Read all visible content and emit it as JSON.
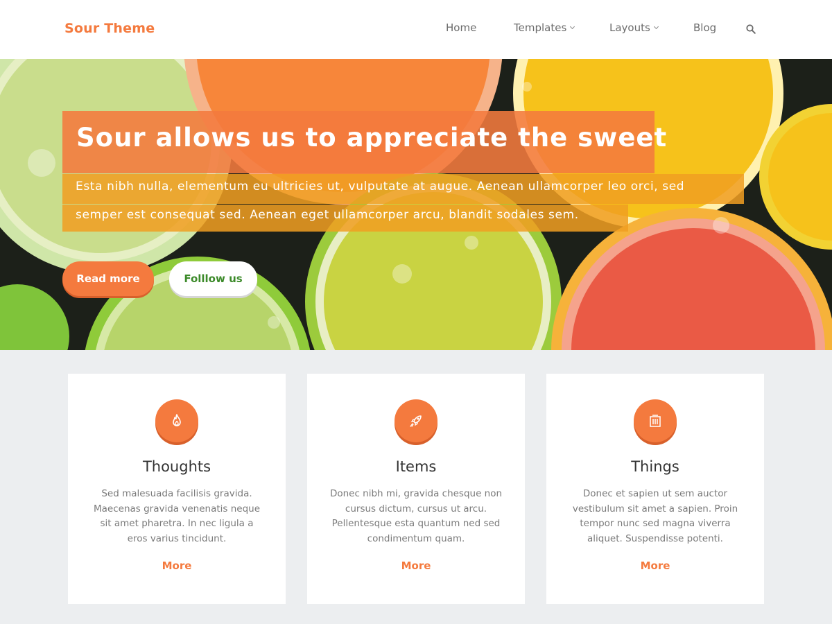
{
  "brand": {
    "name": "Sour Theme",
    "accent": "#f47a3e"
  },
  "nav": {
    "items": [
      {
        "label": "Home"
      },
      {
        "label": "Templates"
      },
      {
        "label": "Layouts"
      },
      {
        "label": "Blog"
      }
    ],
    "search_icon": "search-icon"
  },
  "hero": {
    "title": "Sour allows us to appreciate the sweet",
    "subtitle_line1": "Esta nibh nulla, elementum eu ultricies ut, vulputate at augue. Aenean ullamcorper leo orci, sed",
    "subtitle_line2": "semper est consequat sed. Aenean eget ullamcorper arcu, blandit sodales sem.",
    "primary_button": "Read more",
    "secondary_button": "Folllow us"
  },
  "features": [
    {
      "icon": "flame-icon",
      "title": "Thoughts",
      "text": "Sed malesuada facilisis gravida. Maecenas gravida venenatis neque sit amet pharetra. In nec ligula a eros varius tincidunt.",
      "link": "More"
    },
    {
      "icon": "rocket-icon",
      "title": "Items",
      "text": "Donec nibh mi, gravida chesque non cursus dictum, cursus ut arcu. Pellentesque esta quantum ned sed condimentum quam.",
      "link": "More"
    },
    {
      "icon": "building-icon",
      "title": "Things",
      "text": "Donec et sapien ut sem auctor vestibulum sit amet a sapien. Proin tempor nunc sed magna viverra aliquet. Suspendisse potenti.",
      "link": "More"
    }
  ]
}
